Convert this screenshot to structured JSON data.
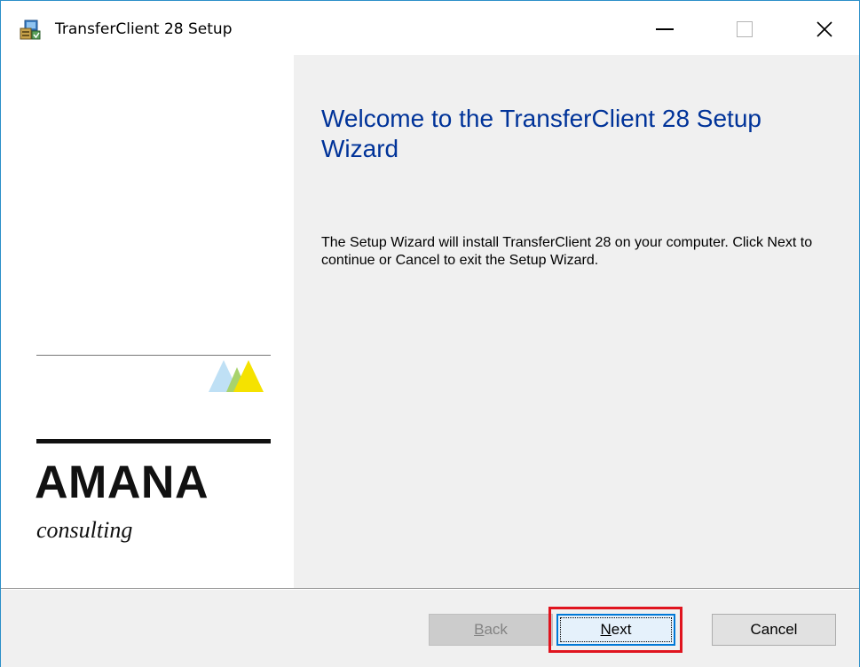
{
  "window": {
    "title": "TransferClient 28 Setup",
    "controls": {
      "minimize_icon": "minimize-icon",
      "maximize_icon": "maximize-icon",
      "close_icon": "close-icon",
      "maximize_enabled": false
    }
  },
  "branding": {
    "logo_name": "AMANA",
    "logo_tagline": "consulting",
    "logo_colors": {
      "triangle_left": "#bfe0f5",
      "triangle_right": "#f5e200"
    }
  },
  "content": {
    "title": "Welcome to the TransferClient 28 Setup Wizard",
    "body": "The Setup Wizard will install TransferClient 28 on your computer. Click Next to continue or Cancel to exit the Setup Wizard."
  },
  "buttons": {
    "back": {
      "label_mnemonic": "B",
      "label_rest": "ack",
      "enabled": false
    },
    "next": {
      "label_mnemonic": "N",
      "label_rest": "ext",
      "enabled": true,
      "focused": true
    },
    "cancel": {
      "label": "Cancel",
      "enabled": true
    }
  },
  "colors": {
    "accent": "#0078d7",
    "title_text": "#003399",
    "highlight_box": "#e0141e"
  }
}
